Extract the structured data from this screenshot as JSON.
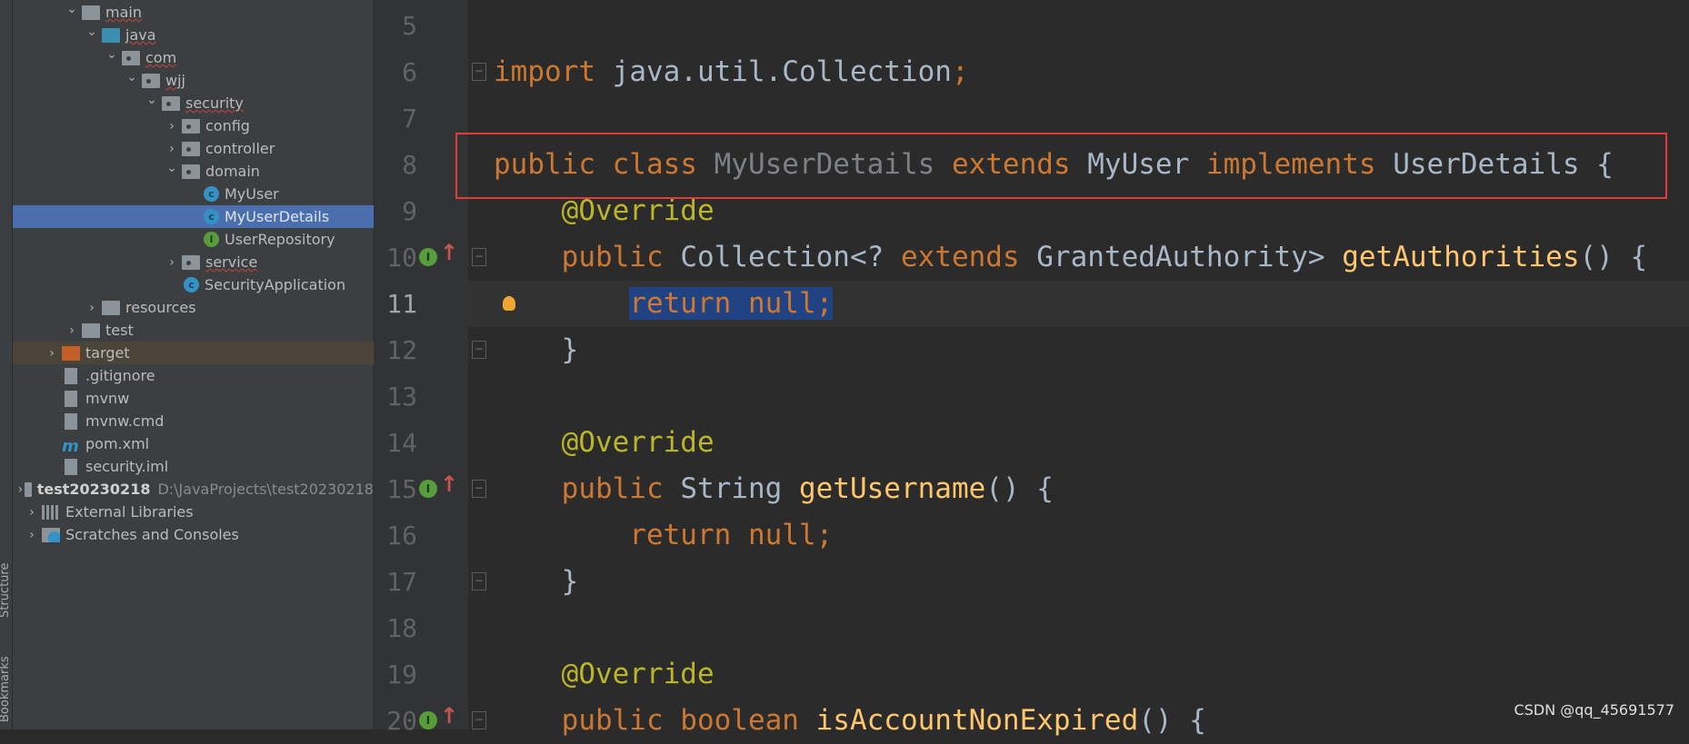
{
  "sidebar": {
    "vertical_tabs": [
      "Structure",
      "Bookmarks"
    ],
    "tree": [
      {
        "label": "main",
        "level": 3,
        "icon": "folder",
        "expanded": true,
        "squiggle": true
      },
      {
        "label": "java",
        "level": 4,
        "icon": "source-folder",
        "expanded": true,
        "squiggle": true
      },
      {
        "label": "com",
        "level": 5,
        "icon": "package",
        "expanded": true,
        "squiggle": true
      },
      {
        "label": "wjj",
        "level": 6,
        "icon": "package",
        "expanded": true,
        "squiggle": true
      },
      {
        "label": "security",
        "level": 7,
        "icon": "package",
        "expanded": true,
        "squiggle": true
      },
      {
        "label": "config",
        "level": 8,
        "icon": "package",
        "expanded": false
      },
      {
        "label": "controller",
        "level": 8,
        "icon": "package",
        "expanded": false
      },
      {
        "label": "domain",
        "level": 8,
        "icon": "package",
        "expanded": true
      },
      {
        "label": "MyUser",
        "level": 9,
        "icon": "class"
      },
      {
        "label": "MyUserDetails",
        "level": 9,
        "icon": "class",
        "selected": true
      },
      {
        "label": "UserRepository",
        "level": 9,
        "icon": "interface"
      },
      {
        "label": "service",
        "level": 8,
        "icon": "package",
        "expanded": false,
        "squiggle": true
      },
      {
        "label": "SecurityApplication",
        "level": 8,
        "icon": "spring-class"
      },
      {
        "label": "resources",
        "level": 4,
        "icon": "resources-folder",
        "expanded": false
      },
      {
        "label": "test",
        "level": 3,
        "icon": "folder",
        "expanded": false
      },
      {
        "label": "target",
        "level": 2,
        "icon": "excluded-folder",
        "expanded": false,
        "excluded": true
      },
      {
        "label": ".gitignore",
        "level": 2,
        "icon": "ignore-file"
      },
      {
        "label": "mvnw",
        "level": 2,
        "icon": "shell-file"
      },
      {
        "label": "mvnw.cmd",
        "level": 2,
        "icon": "text-file"
      },
      {
        "label": "pom.xml",
        "level": 2,
        "icon": "maven-file"
      },
      {
        "label": "security.iml",
        "level": 2,
        "icon": "iml-file"
      },
      {
        "label": "test20230218",
        "level": 1,
        "icon": "module-folder",
        "expanded": false,
        "bold": true,
        "path": "D:\\JavaProjects\\test20230218"
      },
      {
        "label": "External Libraries",
        "level": 1,
        "icon": "libraries",
        "expanded": false
      },
      {
        "label": "Scratches and Consoles",
        "level": 1,
        "icon": "scratches",
        "expanded": false
      }
    ]
  },
  "editor": {
    "current_line": 11,
    "lines": [
      {
        "n": 5,
        "tokens": []
      },
      {
        "n": 6,
        "fold": "start",
        "tokens": [
          {
            "t": "import ",
            "k": "kw"
          },
          {
            "t": "java.util.Collection",
            "k": "ty"
          },
          {
            "t": ";",
            "k": "kw"
          }
        ]
      },
      {
        "n": 7,
        "tokens": []
      },
      {
        "n": 8,
        "tokens": [
          {
            "t": "public class ",
            "k": "kw"
          },
          {
            "t": "MyUserDetails ",
            "k": "un"
          },
          {
            "t": "extends ",
            "k": "kw"
          },
          {
            "t": "MyUser ",
            "k": "ty"
          },
          {
            "t": "implements ",
            "k": "kw"
          },
          {
            "t": "UserDetails {",
            "k": "ty"
          }
        ]
      },
      {
        "n": 9,
        "tokens": [
          {
            "t": "    "
          },
          {
            "t": "@Override",
            "k": "an"
          }
        ]
      },
      {
        "n": 10,
        "impl": true,
        "fold": "start",
        "tokens": [
          {
            "t": "    "
          },
          {
            "t": "public ",
            "k": "kw"
          },
          {
            "t": "Collection<? ",
            "k": "ty"
          },
          {
            "t": "extends ",
            "k": "kw"
          },
          {
            "t": "GrantedAuthority> ",
            "k": "ty"
          },
          {
            "t": "getAuthorities",
            "k": "fn"
          },
          {
            "t": "() {",
            "k": "ty"
          }
        ]
      },
      {
        "n": 11,
        "bulb": true,
        "tokens": [
          {
            "t": "        "
          },
          {
            "t": "return null;",
            "k": "kw",
            "sel": true
          }
        ]
      },
      {
        "n": 12,
        "fold": "end",
        "tokens": [
          {
            "t": "    }",
            "k": "ty"
          }
        ]
      },
      {
        "n": 13,
        "tokens": []
      },
      {
        "n": 14,
        "tokens": [
          {
            "t": "    "
          },
          {
            "t": "@Override",
            "k": "an"
          }
        ]
      },
      {
        "n": 15,
        "impl": true,
        "fold": "start",
        "tokens": [
          {
            "t": "    "
          },
          {
            "t": "public ",
            "k": "kw"
          },
          {
            "t": "String ",
            "k": "ty"
          },
          {
            "t": "getUsername",
            "k": "fn"
          },
          {
            "t": "() {",
            "k": "ty"
          }
        ]
      },
      {
        "n": 16,
        "tokens": [
          {
            "t": "        "
          },
          {
            "t": "return null;",
            "k": "kw"
          }
        ]
      },
      {
        "n": 17,
        "fold": "end",
        "tokens": [
          {
            "t": "    }",
            "k": "ty"
          }
        ]
      },
      {
        "n": 18,
        "tokens": []
      },
      {
        "n": 19,
        "tokens": [
          {
            "t": "    "
          },
          {
            "t": "@Override",
            "k": "an"
          }
        ]
      },
      {
        "n": 20,
        "impl": true,
        "fold": "start",
        "tokens": [
          {
            "t": "    "
          },
          {
            "t": "public boolean ",
            "k": "kw"
          },
          {
            "t": "isAccountNonExpired",
            "k": "fn"
          },
          {
            "t": "() {",
            "k": "ty"
          }
        ]
      }
    ],
    "highlight_box_color": "#e03c3c"
  },
  "watermark": "CSDN @qq_45691577",
  "colors": {
    "keyword": "#cc7832",
    "annotation": "#bbb529",
    "method": "#ffc66d",
    "selection": "#4b6eaf",
    "editor_bg": "#2b2b2b"
  }
}
